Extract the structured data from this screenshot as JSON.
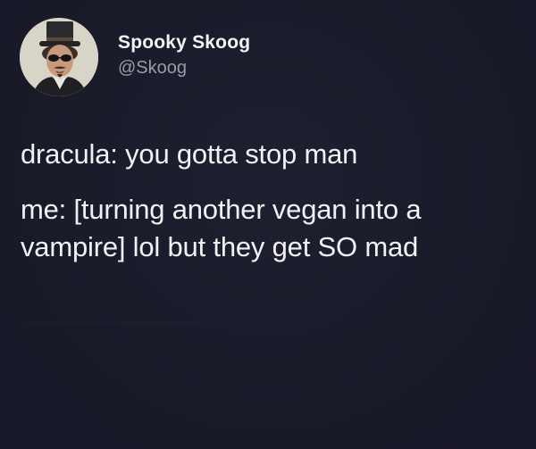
{
  "account": {
    "display_name": "Spooky Skoog",
    "handle": "@Skoog"
  },
  "tweet": {
    "line_1": "dracula: you gotta stop man",
    "line_2": "me: [turning another vegan into a vampire] lol but they get SO mad"
  },
  "icons": {
    "avatar": "profile-photo-top-hat-sunglasses"
  },
  "colors": {
    "background": "#1a1c2b",
    "text": "#f1f1f4",
    "handle_text": "#9a9caa"
  }
}
